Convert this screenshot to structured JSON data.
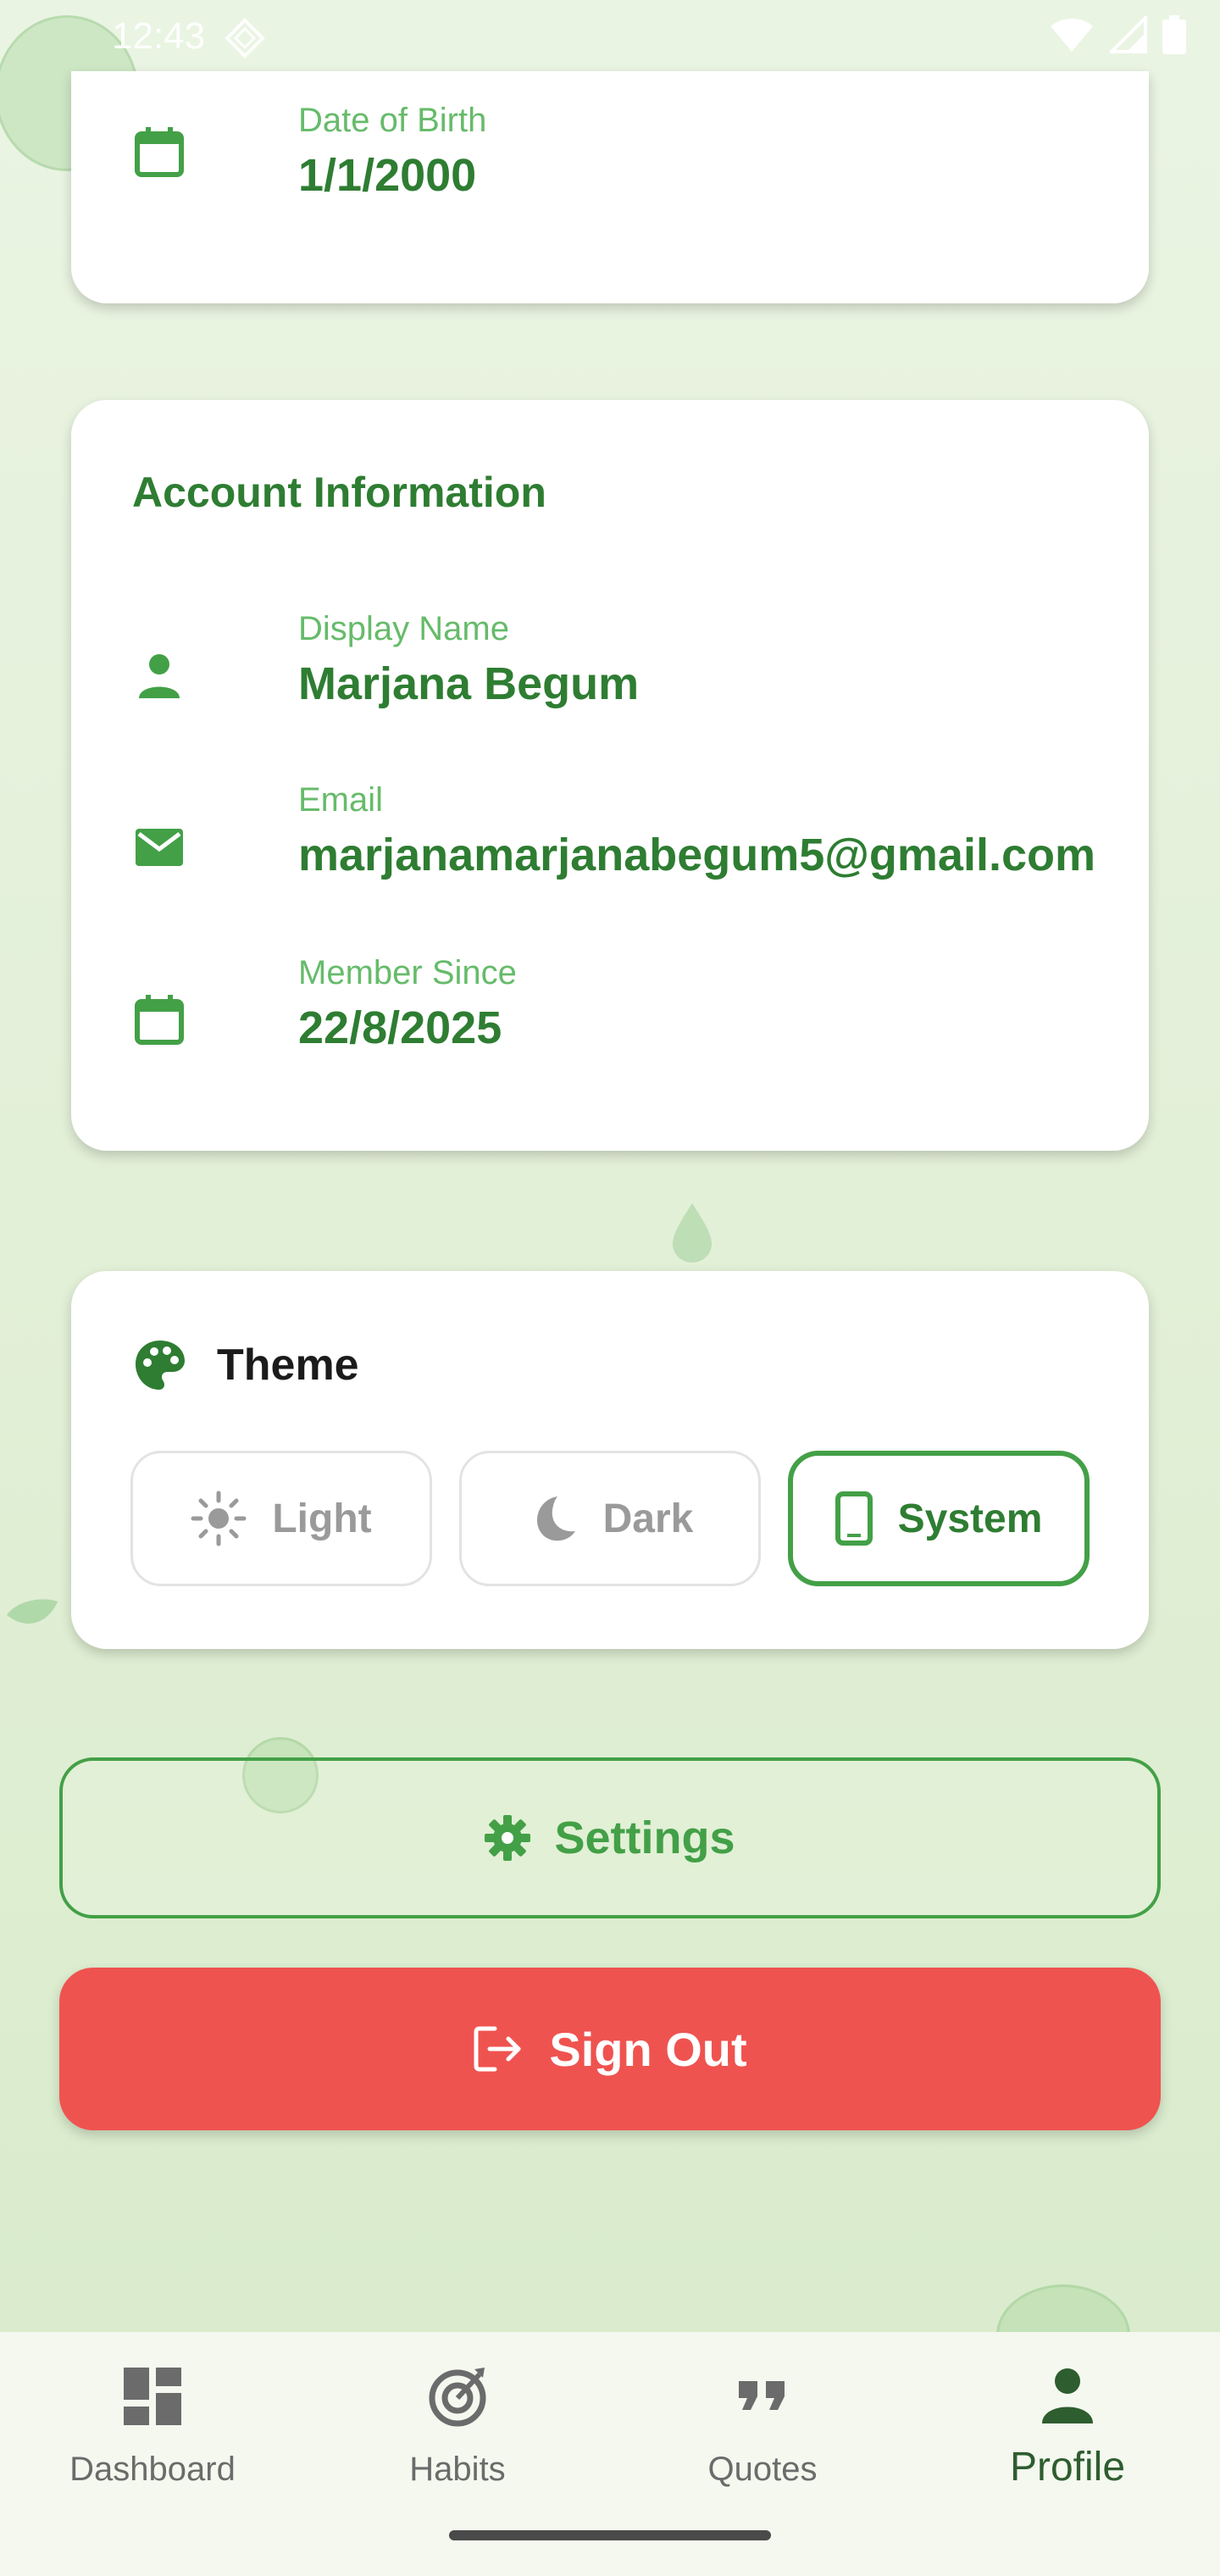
{
  "status_bar": {
    "time": "12:43"
  },
  "personal_card": {
    "dob_label": "Date of Birth",
    "dob_value": "1/1/2000"
  },
  "account_card": {
    "title": "Account Information",
    "display_name_label": "Display Name",
    "display_name_value": "Marjana Begum",
    "email_label": "Email",
    "email_value": "marjanamarjanabegum5@gmail.com",
    "member_since_label": "Member Since",
    "member_since_value": "22/8/2025"
  },
  "theme_card": {
    "title": "Theme",
    "options": [
      {
        "label": "Light",
        "icon": "sun-icon",
        "selected": false
      },
      {
        "label": "Dark",
        "icon": "moon-icon",
        "selected": false
      },
      {
        "label": "System",
        "icon": "phone-icon",
        "selected": true
      }
    ]
  },
  "actions": {
    "settings_label": "Settings",
    "signout_label": "Sign Out"
  },
  "bottom_nav": {
    "items": [
      {
        "label": "Dashboard",
        "icon": "dashboard-icon",
        "active": false
      },
      {
        "label": "Habits",
        "icon": "target-icon",
        "active": false
      },
      {
        "label": "Quotes",
        "icon": "quote-icon",
        "active": false
      },
      {
        "label": "Profile",
        "icon": "person-icon",
        "active": true
      }
    ]
  },
  "colors": {
    "primary_green": "#2e7d32",
    "label_green": "#66bb6a",
    "accent_green": "#43a047",
    "danger_red": "#ef5350",
    "background": "#e3f0d8"
  }
}
